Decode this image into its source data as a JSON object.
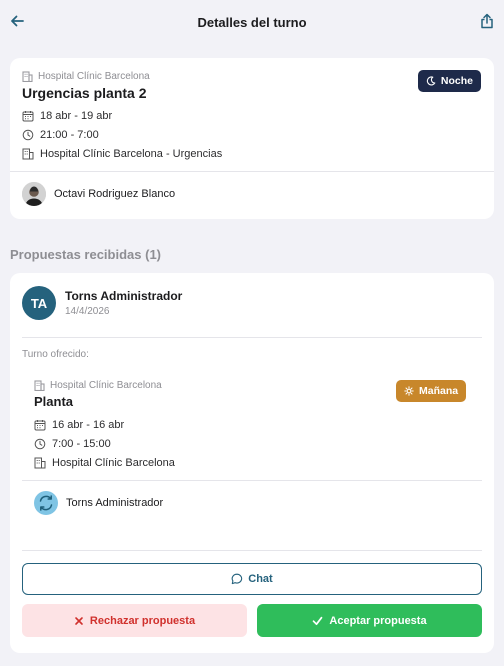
{
  "header": {
    "title": "Detalles del turno",
    "back_icon": "arrow-left-icon",
    "share_icon": "share-icon"
  },
  "shift": {
    "hospital_label": "Hospital Clínic Barcelona",
    "name": "Urgencias planta 2",
    "badge": "Noche",
    "dates": "18 abr - 19 abr",
    "hours": "21:00 - 7:00",
    "location": "Hospital Clínic Barcelona - Urgencias",
    "owner": "Octavi Rodriguez Blanco"
  },
  "proposals": {
    "section_title": "Propuestas recibidas (1)",
    "items": [
      {
        "initials": "TA",
        "proposer": "Torns Administrador",
        "date": "14/4/2026",
        "offered_label": "Turno ofrecido:",
        "offered": {
          "hospital_label": "Hospital Clínic Barcelona",
          "name": "Planta",
          "badge": "Mañana",
          "dates": "16 abr - 16 abr",
          "hours": "7:00 - 15:00",
          "location": "Hospital Clínic Barcelona",
          "owner": "Torns Administrador"
        },
        "chat_label": "Chat",
        "reject_label": "Rechazar propuesta",
        "accept_label": "Aceptar propuesta"
      }
    ]
  },
  "colors": {
    "accent": "#25627d",
    "night_badge": "#1e2a4a",
    "morning_badge": "#c8872b",
    "accept": "#2fbd5b",
    "reject_bg": "#fde3e5",
    "reject_text": "#d0312d",
    "background": "#f2f2f7"
  }
}
